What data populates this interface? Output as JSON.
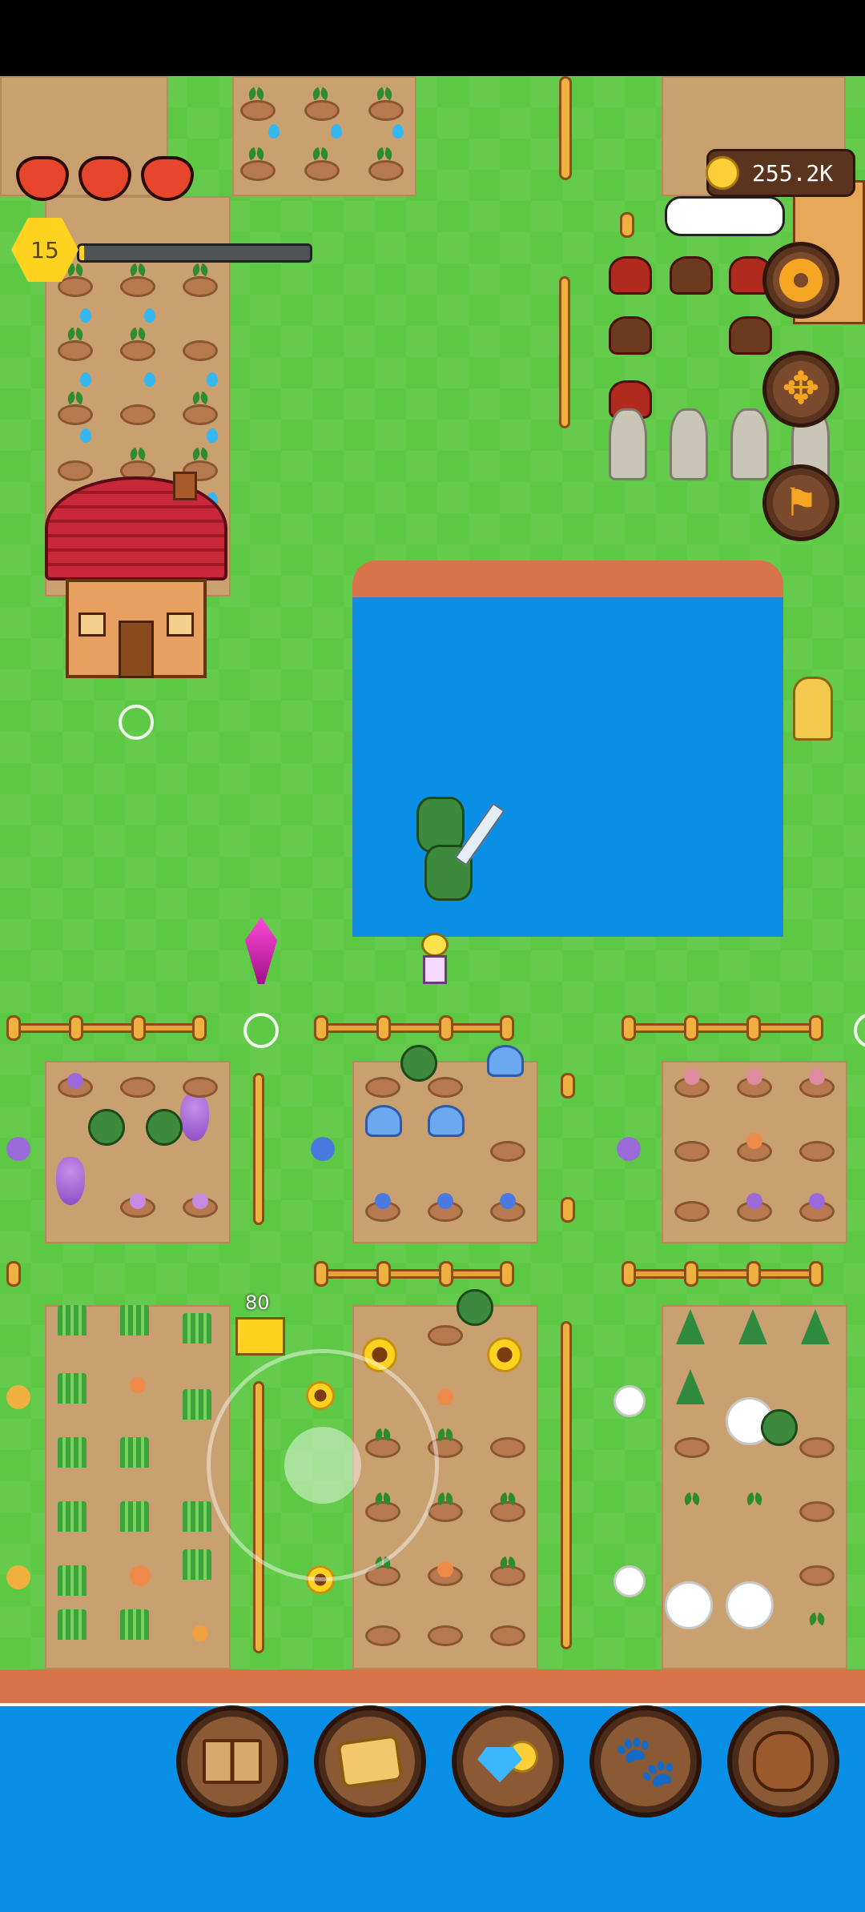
{
  "hud": {
    "hearts": 3,
    "level": "15",
    "xp_progress": 0.02,
    "coins": "255.2K"
  },
  "world": {
    "pylon_count": "80"
  },
  "side_buttons": [
    {
      "name": "settings",
      "icon": "gear-icon"
    },
    {
      "name": "move",
      "icon": "move-arrows-icon"
    },
    {
      "name": "flag",
      "icon": "flag-icon"
    }
  ],
  "dock": [
    {
      "name": "journal",
      "icon": "book-icon"
    },
    {
      "name": "map",
      "icon": "scroll-map-icon"
    },
    {
      "name": "shop",
      "icon": "gem-coin-icon"
    },
    {
      "name": "pets",
      "icon": "paw-icon"
    },
    {
      "name": "inventory",
      "icon": "leather-bag-icon"
    }
  ],
  "colors": {
    "grass": "#5cc843",
    "soil": "#c9a070",
    "water": "#0a8fe6",
    "button_wood": "#5b3420",
    "gear": "#f5a623",
    "level_badge": "#ffd21f"
  }
}
